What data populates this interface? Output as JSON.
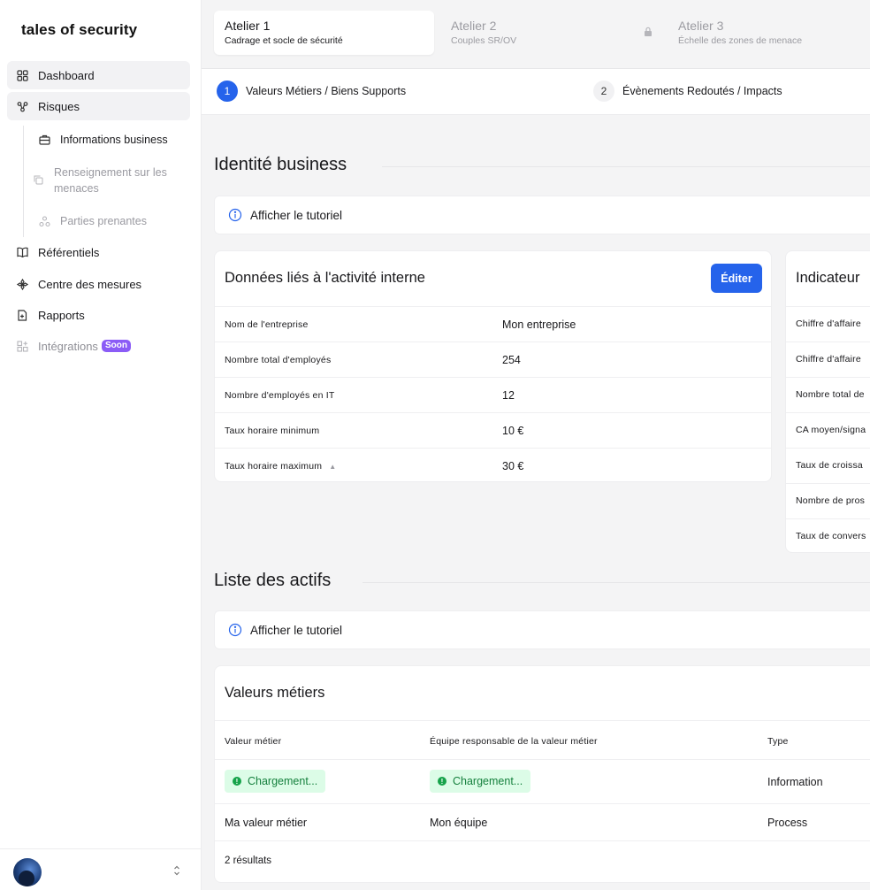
{
  "brand": "tales of security",
  "sidebar": {
    "items": [
      {
        "label": "Dashboard"
      },
      {
        "label": "Risques"
      },
      {
        "label": "Référentiels"
      },
      {
        "label": "Centre des mesures"
      },
      {
        "label": "Rapports"
      },
      {
        "label": "Intégrations",
        "badge": "Soon"
      }
    ],
    "sub_items": [
      {
        "label": "Informations business"
      },
      {
        "label": "Renseignement sur les menaces"
      },
      {
        "label": "Parties prenantes"
      }
    ]
  },
  "ateliers": [
    {
      "title": "Atelier 1",
      "subtitle": "Cadrage et socle de sécurité",
      "active": true
    },
    {
      "title": "Atelier 2",
      "subtitle": "Couples SR/OV",
      "active": false
    },
    {
      "title": "Atelier 3",
      "subtitle": "Échelle des zones de menace",
      "active": false,
      "locked": true
    }
  ],
  "steps": [
    {
      "num": "1",
      "label": "Valeurs Métiers / Biens Supports",
      "active": true
    },
    {
      "num": "2",
      "label": "Évènements Redoutés / Impacts",
      "active": false
    }
  ],
  "identite": {
    "title": "Identité business",
    "tutorial": "Afficher le tutoriel",
    "internal": {
      "title": "Données liés à l'activité interne",
      "edit_label": "Éditer",
      "rows": [
        {
          "key": "Nom de l'entreprise",
          "value": "Mon entreprise"
        },
        {
          "key": "Nombre total d'employés",
          "value": "254"
        },
        {
          "key": "Nombre d'employés en IT",
          "value": "12"
        },
        {
          "key": "Taux horaire minimum",
          "value": "10 €"
        },
        {
          "key": "Taux horaire maximum",
          "value": "30 €"
        }
      ]
    },
    "indicators": {
      "title": "Indicateur",
      "rows": [
        {
          "key": "Chiffre d'affaire"
        },
        {
          "key": "Chiffre d'affaire"
        },
        {
          "key": "Nombre total de"
        },
        {
          "key": "CA moyen/signa"
        },
        {
          "key": "Taux de croissa"
        },
        {
          "key": "Nombre de pros"
        },
        {
          "key": "Taux de convers"
        }
      ]
    }
  },
  "actifs": {
    "title": "Liste des actifs",
    "tutorial": "Afficher le tutoriel",
    "valeurs": {
      "title": "Valeurs métiers",
      "headers": [
        "Valeur métier",
        "Équipe responsable de la valeur métier",
        "Type"
      ],
      "rows": [
        {
          "valeur": "Chargement...",
          "equipe": "Chargement...",
          "type": "Information",
          "loading": true
        },
        {
          "valeur": "Ma valeur métier",
          "equipe": "Mon équipe",
          "type": "Process",
          "loading": false
        }
      ],
      "result_count": "2 résultats"
    }
  }
}
